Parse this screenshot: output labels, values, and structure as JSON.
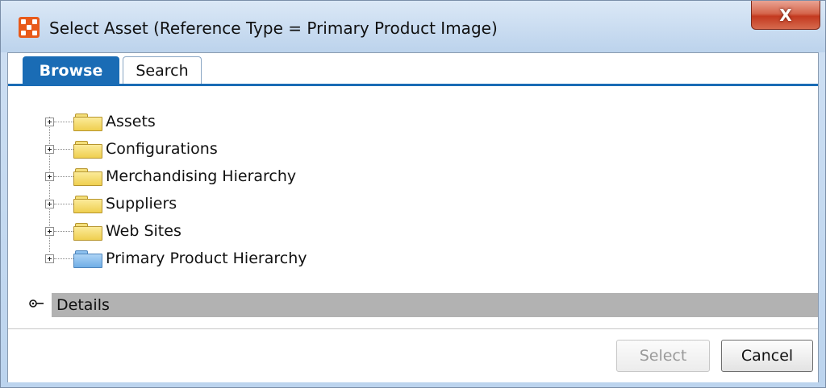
{
  "window": {
    "title": "Select Asset (Reference Type = Primary Product Image)",
    "close_label": "X"
  },
  "tabs": [
    {
      "label": "Browse",
      "active": true
    },
    {
      "label": "Search",
      "active": false
    }
  ],
  "tree": {
    "items": [
      {
        "label": "Assets",
        "icon": "folder-icon",
        "color": "yellow"
      },
      {
        "label": "Configurations",
        "icon": "folder-icon",
        "color": "yellow"
      },
      {
        "label": "Merchandising Hierarchy",
        "icon": "folder-icon",
        "color": "yellow"
      },
      {
        "label": "Suppliers",
        "icon": "folder-icon",
        "color": "yellow"
      },
      {
        "label": "Web Sites",
        "icon": "folder-icon",
        "color": "yellow"
      },
      {
        "label": "Primary Product Hierarchy",
        "icon": "folder-icon",
        "color": "blue"
      }
    ]
  },
  "details": {
    "label": "Details",
    "icon": "key-icon"
  },
  "buttons": {
    "select_label": "Select",
    "select_enabled": false,
    "cancel_label": "Cancel"
  },
  "colors": {
    "accent": "#1a6cb5",
    "close_button": "#c3391f",
    "app_icon": "#e85a1a"
  }
}
